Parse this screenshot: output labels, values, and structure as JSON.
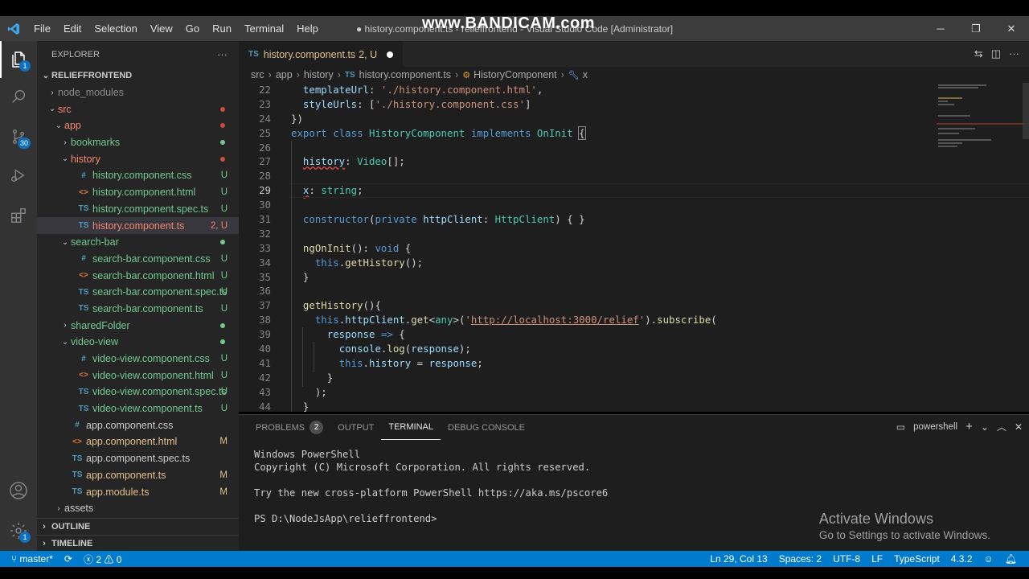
{
  "watermark": "www.BANDICAM.com",
  "window": {
    "title": "● history.component.ts - relieffrontend - Visual Studio Code [Administrator]",
    "menu": [
      "File",
      "Edit",
      "Selection",
      "View",
      "Go",
      "Run",
      "Terminal",
      "Help"
    ],
    "controls": {
      "minimize": "─",
      "restore": "❐",
      "close": "✕"
    }
  },
  "activity_bar": {
    "icons": [
      "files-icon",
      "search-icon",
      "source-control-icon",
      "run-debug-icon",
      "extensions-icon",
      "account-icon",
      "settings-gear-icon"
    ],
    "source_control_badge": "30",
    "explorer_badge": "1",
    "settings_badge": "1"
  },
  "sidebar": {
    "header": "EXPLORER",
    "more": "···",
    "root": "RELIEFFRONTEND",
    "tree": [
      {
        "label": "node_modules",
        "depth": 1,
        "chev": "›",
        "kind": "folder",
        "color": "#8c8c8c"
      },
      {
        "label": "src",
        "depth": 1,
        "chev": "⌄",
        "kind": "folder",
        "color": "#f48771",
        "dot": "#c74e39"
      },
      {
        "label": "app",
        "depth": 2,
        "chev": "⌄",
        "kind": "folder",
        "color": "#f48771",
        "dot": "#c74e39"
      },
      {
        "label": "bookmarks",
        "depth": 3,
        "chev": "›",
        "kind": "folder",
        "color": "#73c991",
        "dot": "#73c991"
      },
      {
        "label": "history",
        "depth": 3,
        "chev": "⌄",
        "kind": "folder",
        "color": "#f48771",
        "dot": "#c74e39"
      },
      {
        "label": "history.component.css",
        "depth": 4,
        "kind": "css",
        "color": "#73c991",
        "badge": "U"
      },
      {
        "label": "history.component.html",
        "depth": 4,
        "kind": "html",
        "color": "#73c991",
        "badge": "U"
      },
      {
        "label": "history.component.spec.ts",
        "depth": 4,
        "kind": "ts",
        "color": "#73c991",
        "badge": "U"
      },
      {
        "label": "history.component.ts",
        "depth": 4,
        "kind": "ts",
        "color": "#f48771",
        "badge": "2, U",
        "selected": true
      },
      {
        "label": "search-bar",
        "depth": 3,
        "chev": "⌄",
        "kind": "folder",
        "color": "#73c991",
        "dot": "#73c991"
      },
      {
        "label": "search-bar.component.css",
        "depth": 4,
        "kind": "css",
        "color": "#73c991",
        "badge": "U"
      },
      {
        "label": "search-bar.component.html",
        "depth": 4,
        "kind": "html",
        "color": "#73c991",
        "badge": "U"
      },
      {
        "label": "search-bar.component.spec.ts",
        "depth": 4,
        "kind": "ts",
        "color": "#73c991",
        "badge": "U"
      },
      {
        "label": "search-bar.component.ts",
        "depth": 4,
        "kind": "ts",
        "color": "#73c991",
        "badge": "U"
      },
      {
        "label": "sharedFolder",
        "depth": 3,
        "chev": "›",
        "kind": "folder",
        "color": "#73c991",
        "dot": "#73c991"
      },
      {
        "label": "video-view",
        "depth": 3,
        "chev": "⌄",
        "kind": "folder",
        "color": "#73c991",
        "dot": "#73c991"
      },
      {
        "label": "video-view.component.css",
        "depth": 4,
        "kind": "css",
        "color": "#73c991",
        "badge": "U"
      },
      {
        "label": "video-view.component.html",
        "depth": 4,
        "kind": "html",
        "color": "#73c991",
        "badge": "U"
      },
      {
        "label": "video-view.component.spec.ts",
        "depth": 4,
        "kind": "ts",
        "color": "#73c991",
        "badge": "U"
      },
      {
        "label": "video-view.component.ts",
        "depth": 4,
        "kind": "ts",
        "color": "#73c991",
        "badge": "U"
      },
      {
        "label": "app.component.css",
        "depth": 3,
        "kind": "css",
        "color": "#cccccc"
      },
      {
        "label": "app.component.html",
        "depth": 3,
        "kind": "html",
        "color": "#e2c08d",
        "badge": "M"
      },
      {
        "label": "app.component.spec.ts",
        "depth": 3,
        "kind": "ts",
        "color": "#cccccc"
      },
      {
        "label": "app.component.ts",
        "depth": 3,
        "kind": "ts",
        "color": "#e2c08d",
        "badge": "M"
      },
      {
        "label": "app.module.ts",
        "depth": 3,
        "kind": "ts",
        "color": "#e2c08d",
        "badge": "M"
      },
      {
        "label": "assets",
        "depth": 2,
        "chev": "›",
        "kind": "folder",
        "color": "#cccccc"
      }
    ],
    "sections": [
      "OUTLINE",
      "TIMELINE"
    ]
  },
  "editor": {
    "tab": {
      "label": "history.component.ts",
      "status": "2, U",
      "icon": "TS"
    },
    "breadcrumb": [
      "src",
      "app",
      "history",
      "history.component.ts",
      "HistoryComponent",
      "x"
    ],
    "current_line": 29,
    "lines": [
      {
        "n": "22",
        "html": "  <span class=\"vr\">templateUrl</span>: <span class=\"st\">'./history.component.html'</span>,"
      },
      {
        "n": "23",
        "html": "  <span class=\"vr\">styleUrls</span>: [<span class=\"st\">'./history.component.css'</span>]"
      },
      {
        "n": "24",
        "html": "})"
      },
      {
        "n": "25",
        "html": "<span class=\"kw\">export</span> <span class=\"kw\">class</span> <span class=\"ty\">HistoryComponent</span> <span class=\"kw\">implements</span> <span class=\"ty\">OnInit</span> <span class=\"bracket-hl\">{</span>"
      },
      {
        "n": "26",
        "html": ""
      },
      {
        "n": "27",
        "html": "  <span class=\"vr sq\">history</span>: <span class=\"ty\">Video</span>[];"
      },
      {
        "n": "28",
        "html": ""
      },
      {
        "n": "29",
        "html": "  <span class=\"vr sq\">x</span>: <span class=\"ty\">string</span>;"
      },
      {
        "n": "30",
        "html": ""
      },
      {
        "n": "31",
        "html": "  <span class=\"kw\">constructor</span>(<span class=\"kw\">private</span> <span class=\"vr\">httpClient</span>: <span class=\"ty\">HttpClient</span>) { }"
      },
      {
        "n": "32",
        "html": ""
      },
      {
        "n": "33",
        "html": "  <span class=\"fn\">ngOnInit</span>(): <span class=\"kw\">void</span> {"
      },
      {
        "n": "34",
        "html": "    <span class=\"kw\">this</span>.<span class=\"fn\">getHistory</span>();"
      },
      {
        "n": "35",
        "html": "  }"
      },
      {
        "n": "36",
        "html": ""
      },
      {
        "n": "37",
        "html": "  <span class=\"fn\">getHistory</span>(){"
      },
      {
        "n": "38",
        "html": "    <span class=\"kw\">this</span>.<span class=\"vr\">httpClient</span>.<span class=\"fn\">get</span>&lt;<span class=\"ty\">any</span>&gt;(<span class=\"st\">'<u>http://localhost:3000/relief</u>'</span>).<span class=\"fn\">subscribe</span>("
      },
      {
        "n": "39",
        "html": "      <span class=\"vr\">response</span> <span class=\"kw\">=&gt;</span> {"
      },
      {
        "n": "40",
        "html": "        <span class=\"vr\">console</span>.<span class=\"fn\">log</span>(<span class=\"vr\">response</span>);"
      },
      {
        "n": "41",
        "html": "        <span class=\"kw\">this</span>.<span class=\"vr\">history</span> = <span class=\"vr\">response</span>;"
      },
      {
        "n": "42",
        "html": "      }"
      },
      {
        "n": "43",
        "html": "    );"
      },
      {
        "n": "44",
        "html": "  }"
      }
    ]
  },
  "panel": {
    "tabs": [
      {
        "label": "PROBLEMS",
        "badge": "2"
      },
      {
        "label": "OUTPUT"
      },
      {
        "label": "TERMINAL",
        "active": true
      },
      {
        "label": "DEBUG CONSOLE"
      }
    ],
    "shell": "powershell",
    "terminal_lines": [
      "Windows PowerShell",
      "Copyright (C) Microsoft Corporation. All rights reserved.",
      "",
      "Try the new cross-platform PowerShell https://aka.ms/pscore6",
      "",
      "PS D:\\NodeJsApp\\relieffrontend>"
    ],
    "activation_title": "Activate Windows",
    "activation_sub": "Go to Settings to activate Windows."
  },
  "status_bar": {
    "branch": "master*",
    "errors": "2",
    "warnings": "0",
    "position": "Ln 29, Col 13",
    "spaces": "Spaces: 2",
    "encoding": "UTF-8",
    "eol": "LF",
    "language": "TypeScript",
    "version": "4.3.2"
  },
  "colors": {
    "accent": "#007acc",
    "modified": "#e2c08d",
    "untracked": "#73c991",
    "error": "#f48771"
  }
}
